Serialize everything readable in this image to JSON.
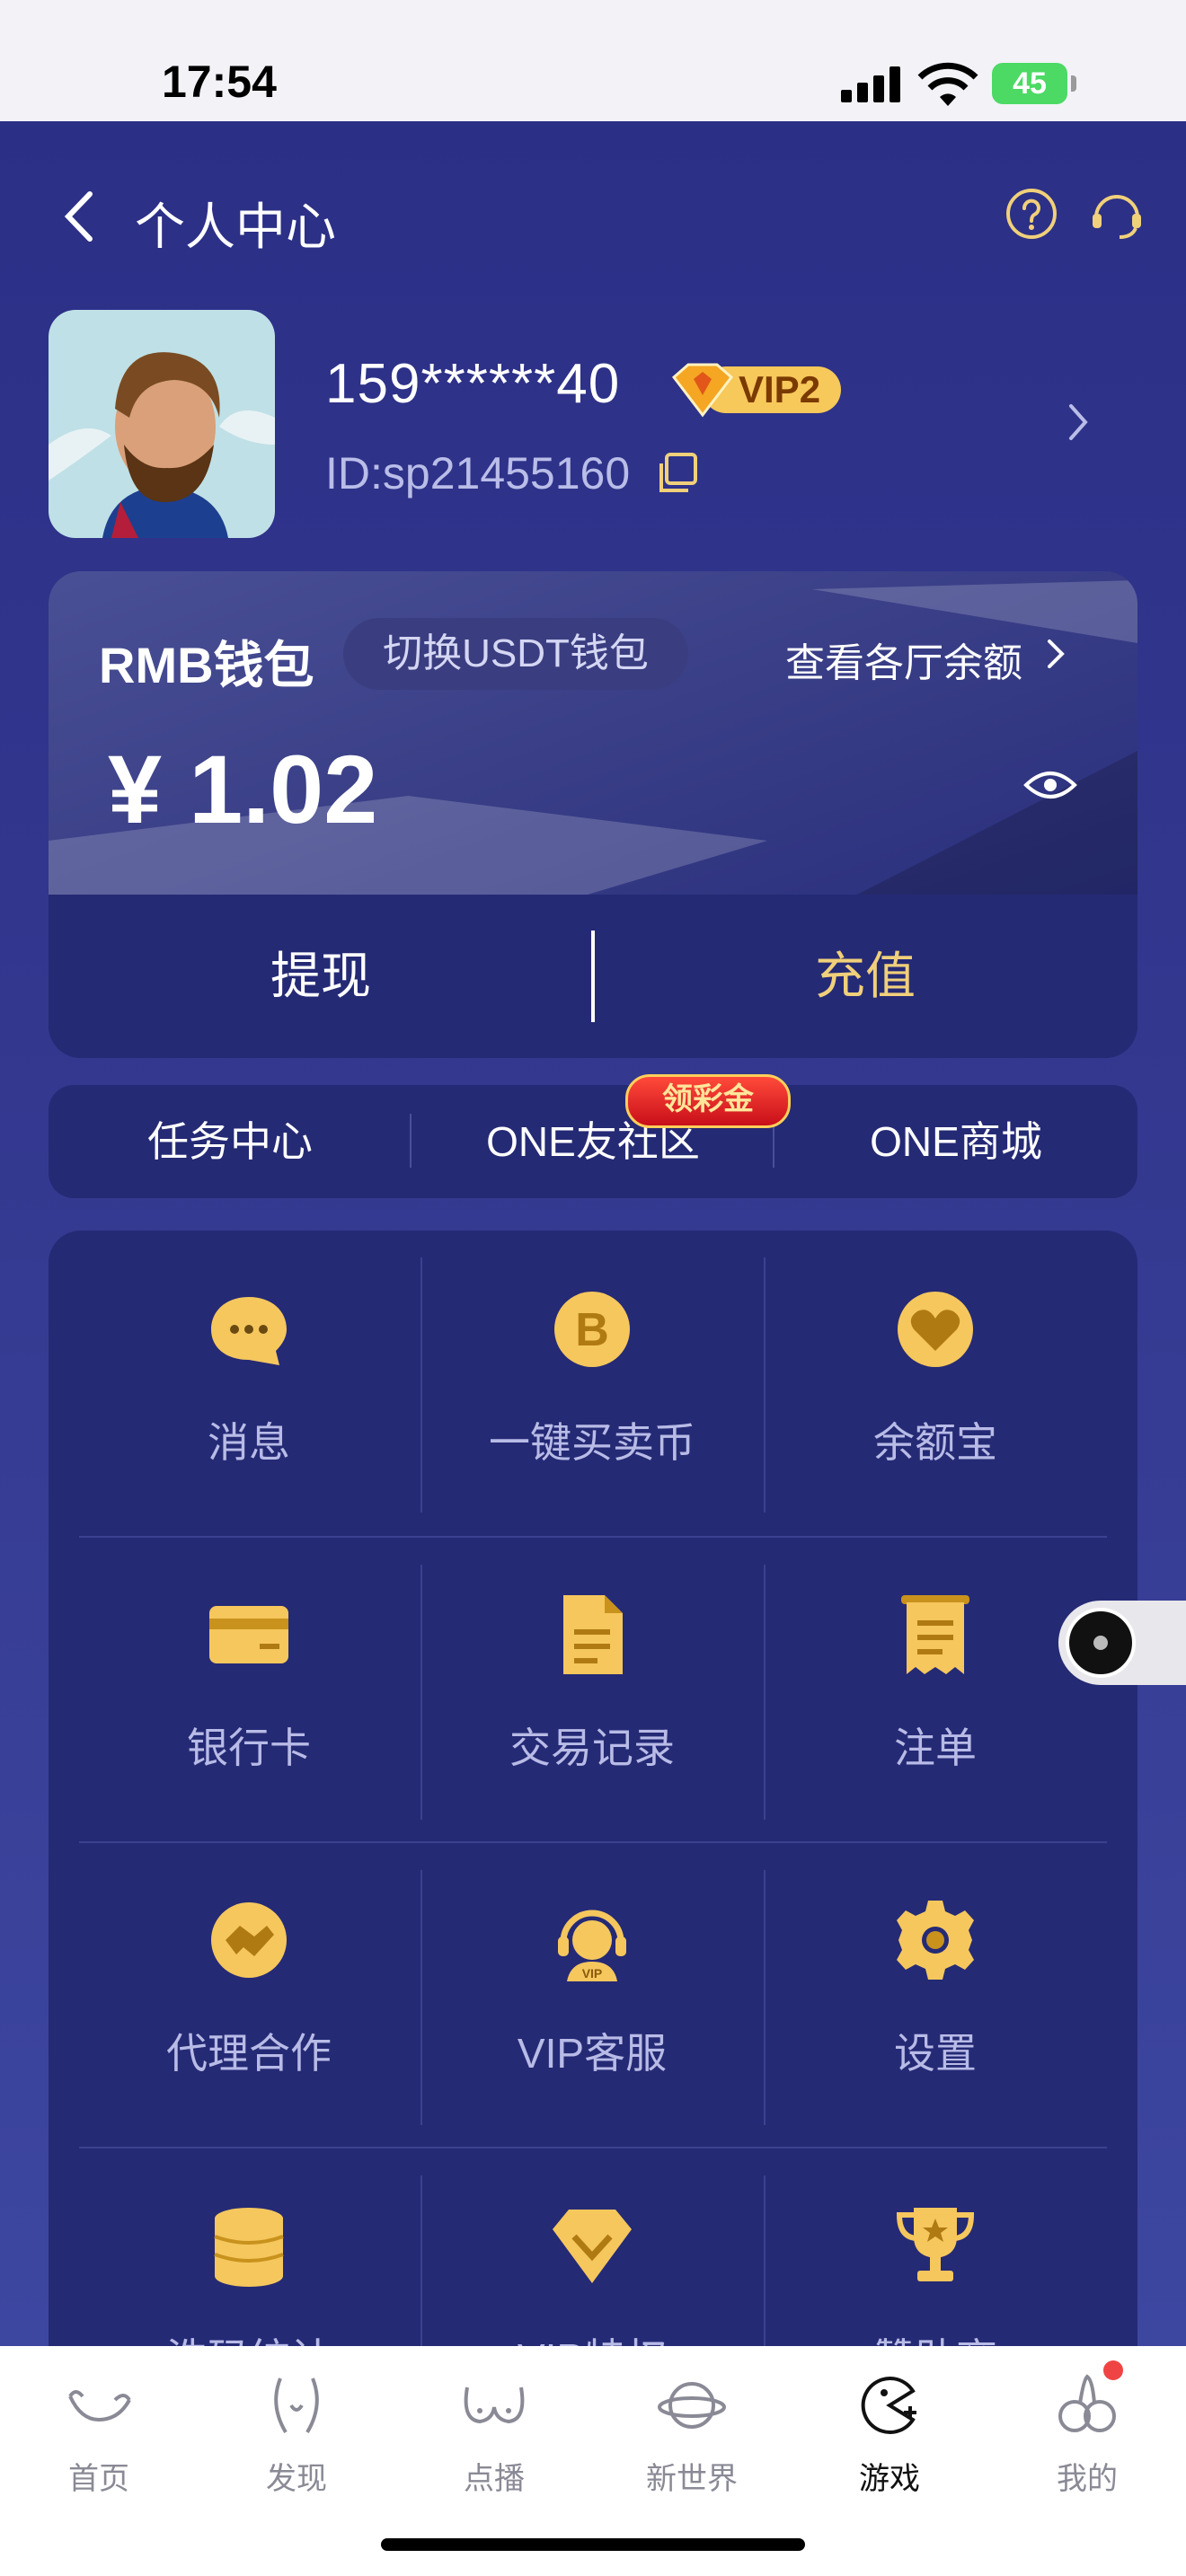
{
  "status_bar": {
    "time": "17:54",
    "battery": "45"
  },
  "header": {
    "title": "个人中心"
  },
  "user": {
    "phone": "159******40",
    "vip_level": "VIP2",
    "id": "ID:sp21455160"
  },
  "wallet": {
    "name": "RMB钱包",
    "switch_label": "切换USDT钱包",
    "balances_link": "查看各厅余额",
    "amount": "¥ 1.02",
    "withdraw_label": "提现",
    "deposit_label": "充值"
  },
  "quick_links": [
    "任务中心",
    "ONE友社区",
    "ONE商城"
  ],
  "gift_badge": "领彩金",
  "grid": [
    {
      "label": "消息",
      "icon": "message-icon"
    },
    {
      "label": "一键买卖币",
      "icon": "bitcoin-icon"
    },
    {
      "label": "余额宝",
      "icon": "heart-coin-icon"
    },
    {
      "label": "银行卡",
      "icon": "bank-card-icon"
    },
    {
      "label": "交易记录",
      "icon": "document-icon"
    },
    {
      "label": "注单",
      "icon": "receipt-icon"
    },
    {
      "label": "代理合作",
      "icon": "handshake-icon"
    },
    {
      "label": "VIP客服",
      "icon": "headset-icon"
    },
    {
      "label": "设置",
      "icon": "gear-icon"
    },
    {
      "label": "洗码统计",
      "icon": "coin-stack-icon"
    },
    {
      "label": "VIP特权",
      "icon": "diamond-icon"
    },
    {
      "label": "赞助商",
      "icon": "trophy-icon"
    }
  ],
  "tabs": [
    {
      "label": "首页",
      "icon": "home-icon"
    },
    {
      "label": "发现",
      "icon": "discover-icon"
    },
    {
      "label": "点播",
      "icon": "vod-icon"
    },
    {
      "label": "新世界",
      "icon": "planet-icon"
    },
    {
      "label": "游戏",
      "icon": "game-icon",
      "active": true
    },
    {
      "label": "我的",
      "icon": "profile-icon"
    }
  ],
  "colors": {
    "accent_gold": "#f0d07a",
    "background": "#2b2f86",
    "card": "#252a75"
  }
}
